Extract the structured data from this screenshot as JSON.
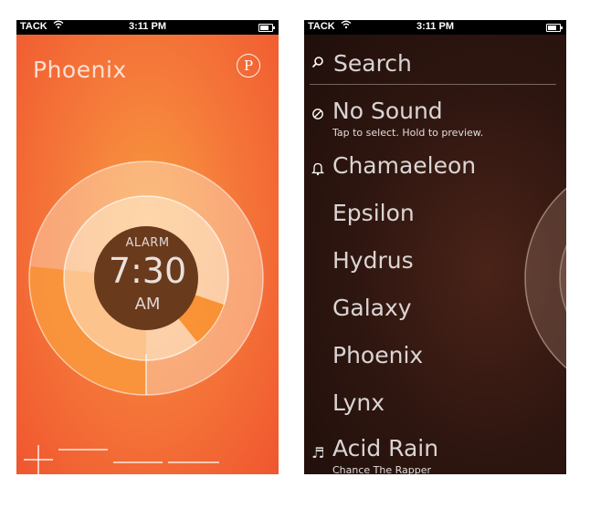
{
  "left_screen": {
    "status": {
      "carrier": "TACK",
      "time": "3:11 PM"
    },
    "title": "Phoenix",
    "badge": "P",
    "alarm": {
      "label": "ALARM",
      "time": "7:30",
      "period": "AM"
    },
    "colors": {
      "bg_top": "#f0562f",
      "bg_mid": "#f79a3e",
      "center": "#6a3a1c"
    }
  },
  "right_screen": {
    "status": {
      "carrier": "TACK",
      "time": "3:11 PM"
    },
    "search": {
      "placeholder": "Search",
      "icon": "search-icon"
    },
    "sounds": [
      {
        "name": "No Sound",
        "subtitle": "Tap to select. Hold to preview.",
        "icon": "no-sound-icon",
        "glyph": "⊘"
      },
      {
        "name": "Chamaeleon",
        "subtitle": "",
        "icon": "bell-icon",
        "glyph": "♫"
      },
      {
        "name": "Epsilon",
        "subtitle": "",
        "icon": "",
        "glyph": ""
      },
      {
        "name": "Hydrus",
        "subtitle": "",
        "icon": "",
        "glyph": ""
      },
      {
        "name": "Galaxy",
        "subtitle": "",
        "icon": "",
        "glyph": ""
      },
      {
        "name": "Phoenix",
        "subtitle": "",
        "icon": "",
        "glyph": ""
      },
      {
        "name": "Lynx",
        "subtitle": "",
        "icon": "",
        "glyph": ""
      },
      {
        "name": "Acid Rain",
        "subtitle": "Chance The Rapper",
        "icon": "music-note-icon",
        "glyph": "♬"
      }
    ]
  }
}
